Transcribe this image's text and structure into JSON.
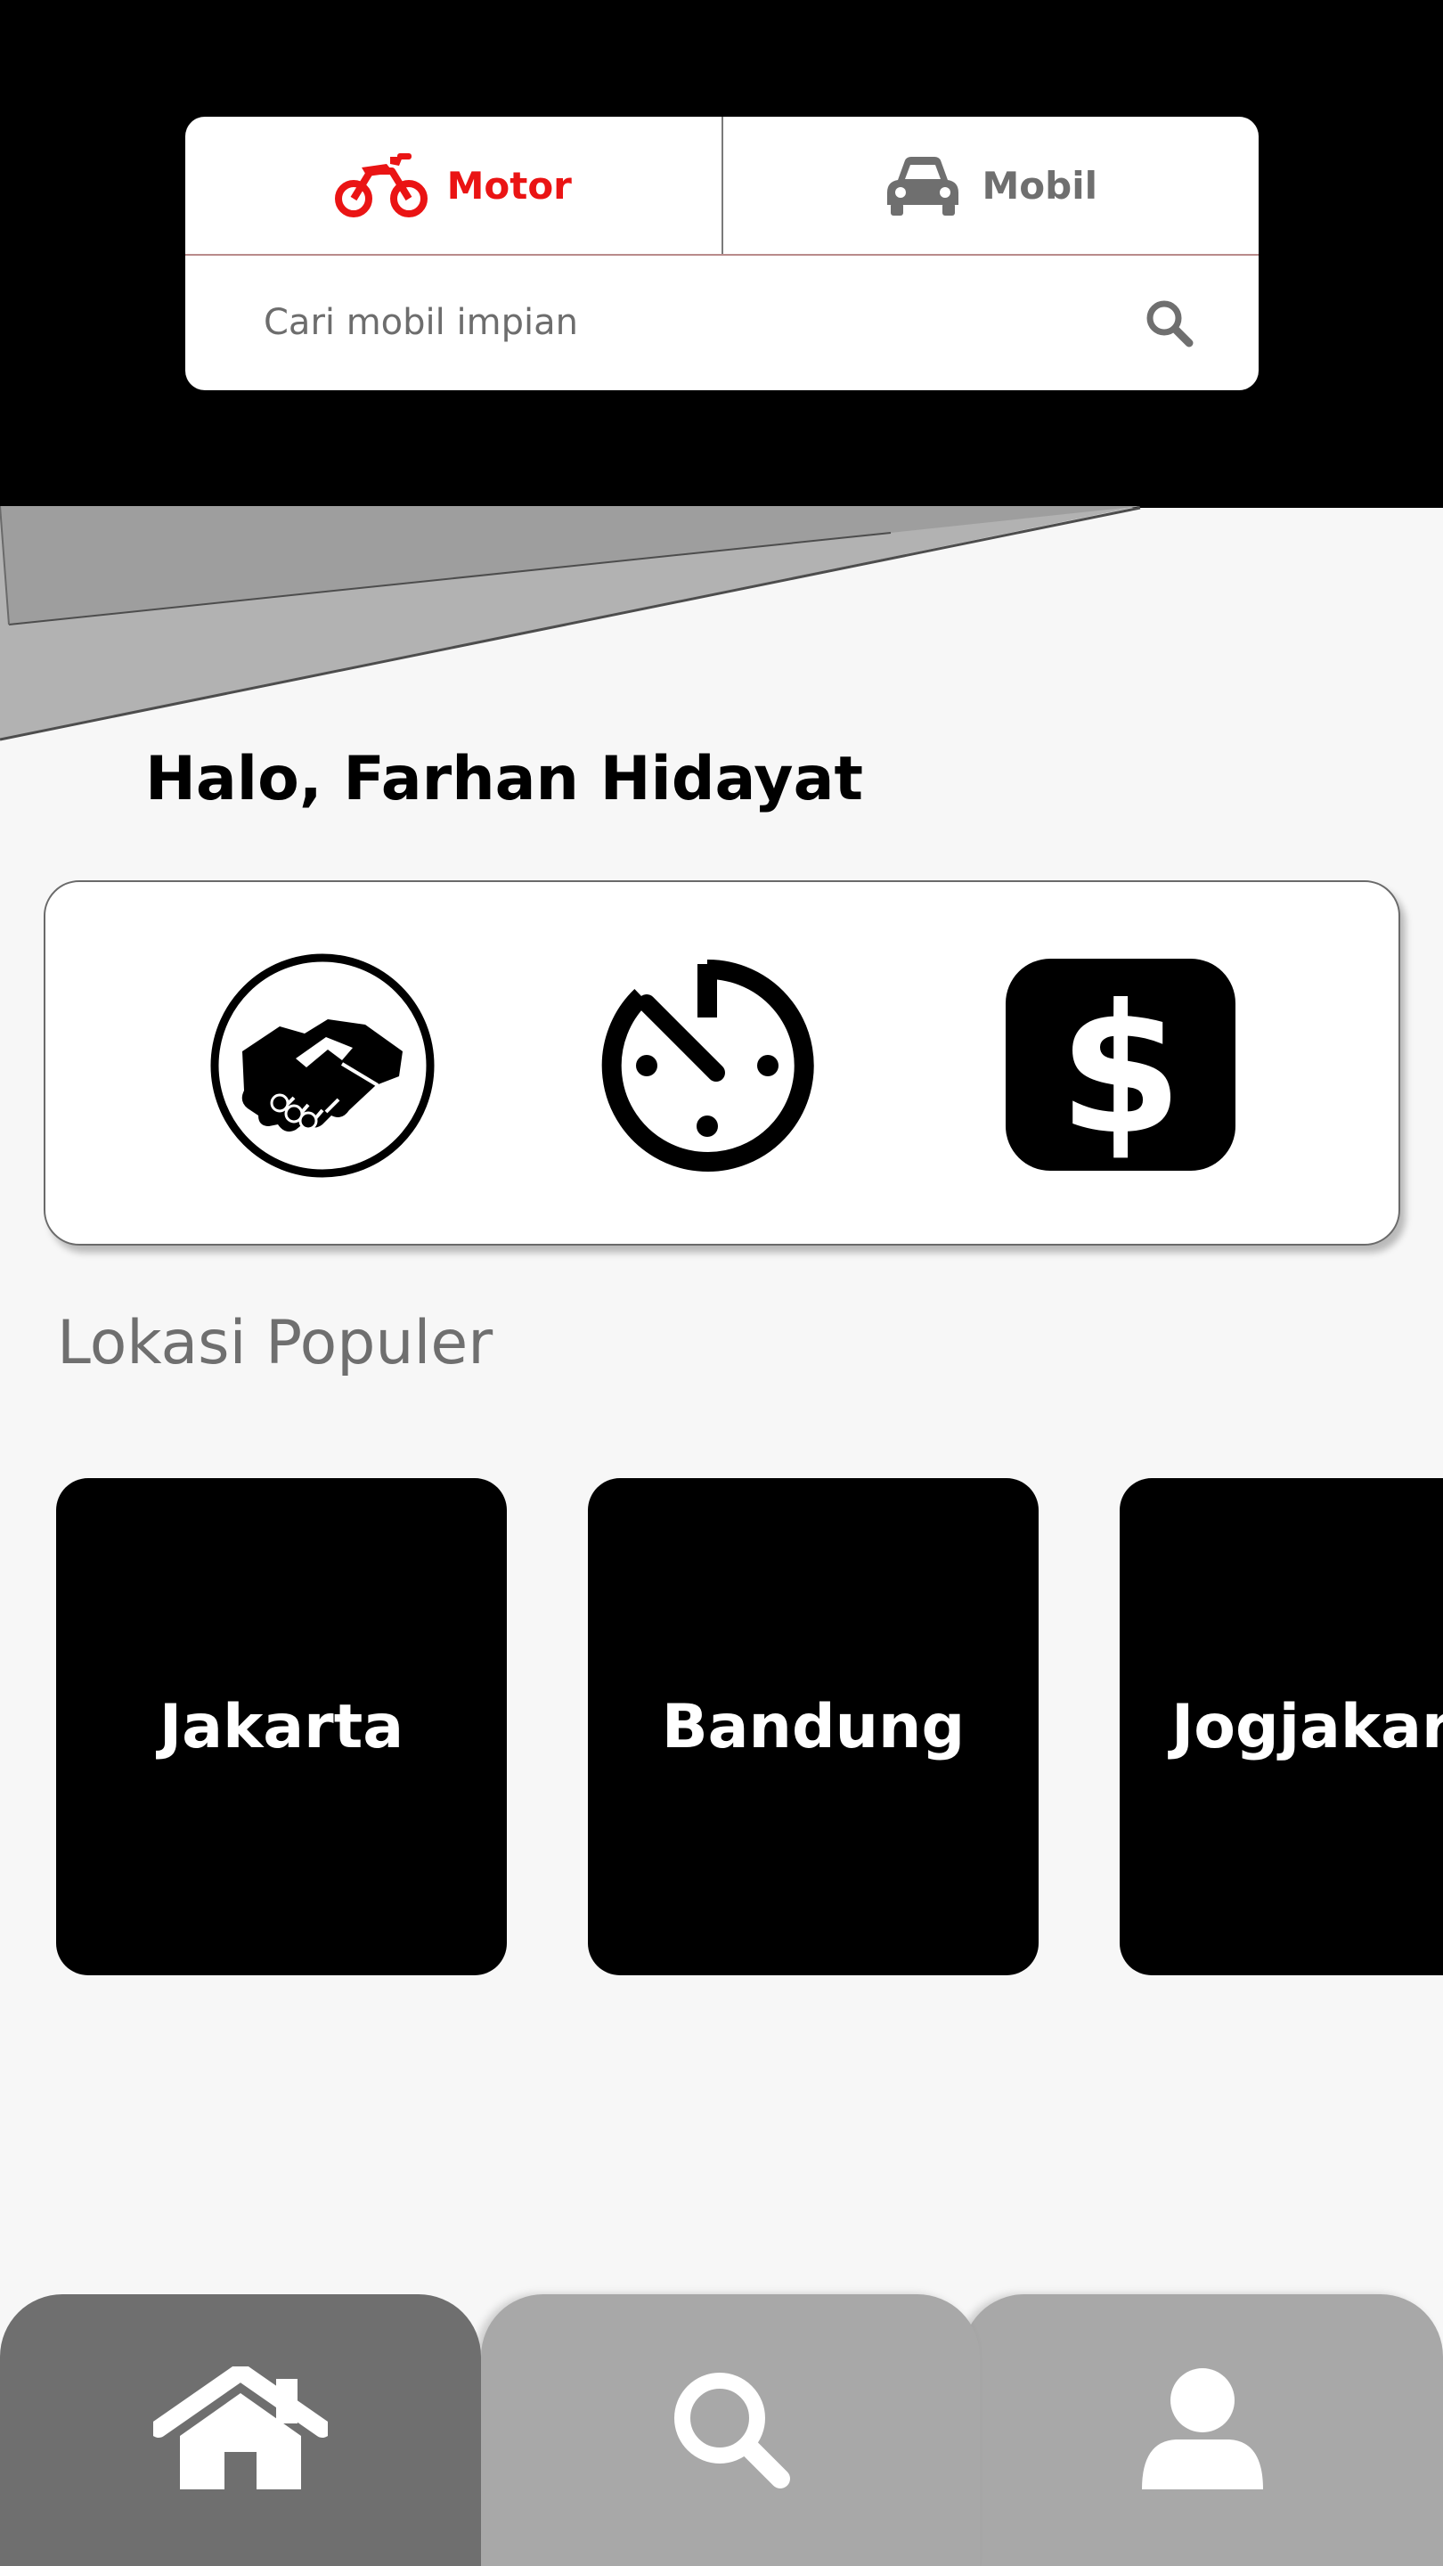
{
  "tabs": {
    "motor": {
      "label": "Motor",
      "icon": "motorcycle-icon",
      "color": "#ea1414",
      "active": true
    },
    "mobil": {
      "label": "Mobil",
      "icon": "car-icon",
      "color": "#6f6f6f",
      "active": false
    }
  },
  "search": {
    "placeholder": "Cari mobil impian",
    "icon": "search-icon"
  },
  "greeting": "Halo, Farhan Hidayat",
  "services": [
    {
      "icon": "handshake-icon"
    },
    {
      "icon": "timer-icon"
    },
    {
      "icon": "dollar-icon"
    }
  ],
  "popular": {
    "title": "Lokasi Populer",
    "locations": [
      "Jakarta",
      "Bandung",
      "Jogjakarta"
    ]
  },
  "bottom_nav": [
    {
      "icon": "home-icon",
      "active": true
    },
    {
      "icon": "search-icon",
      "active": false
    },
    {
      "icon": "profile-icon",
      "active": false
    }
  ]
}
